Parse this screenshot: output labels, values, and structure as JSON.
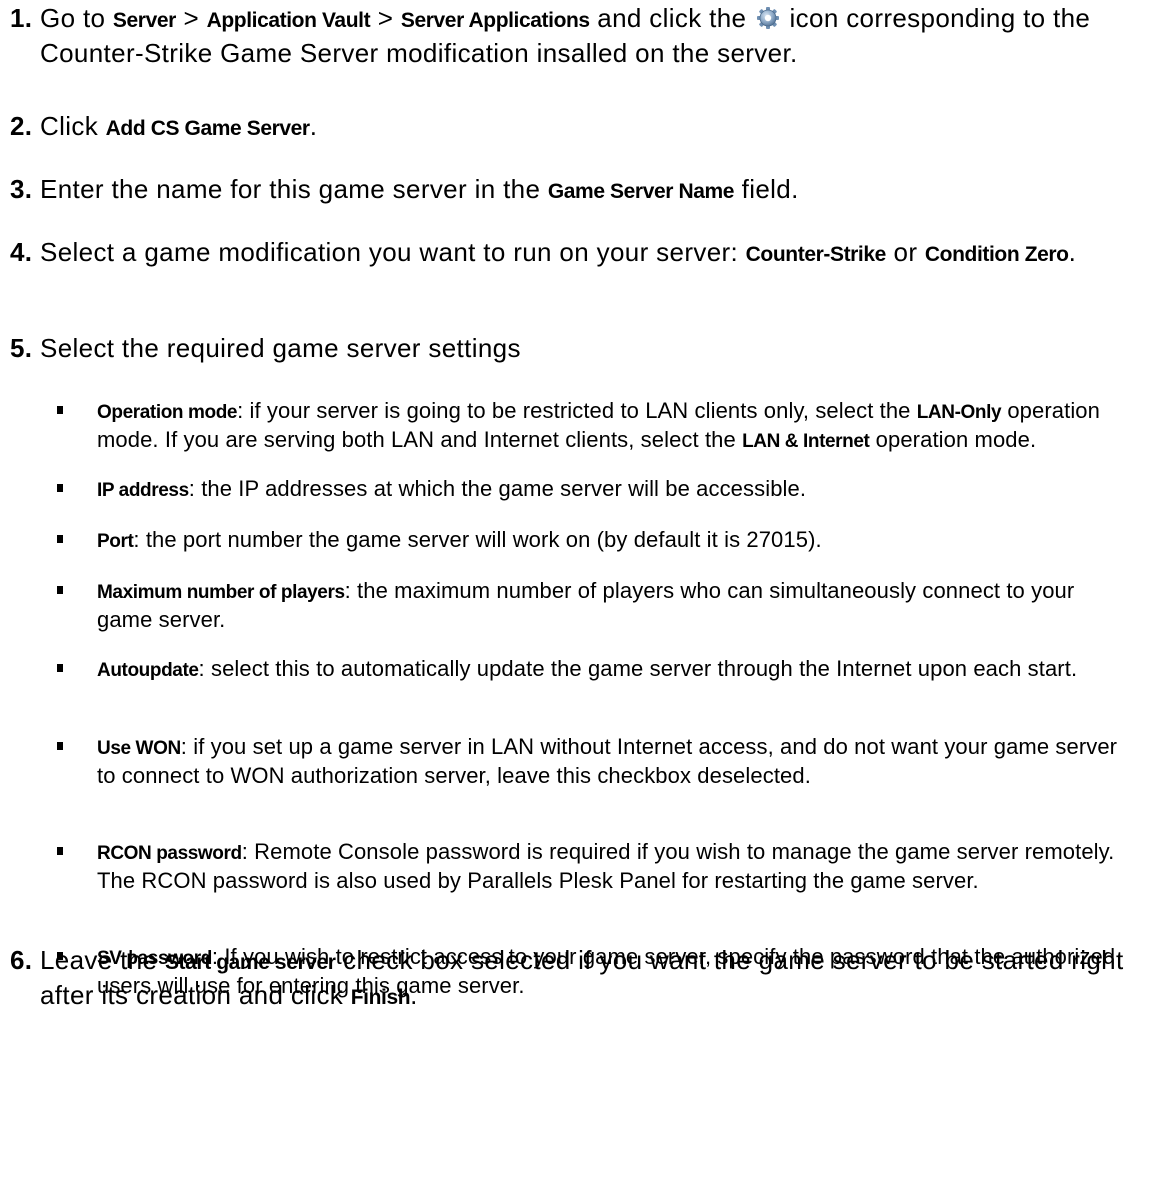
{
  "steps": [
    {
      "number": "1.",
      "parts": [
        {
          "t": "Go to "
        },
        {
          "b": "Server"
        },
        {
          "t": " > "
        },
        {
          "b": "Application Vault"
        },
        {
          "t": " > "
        },
        {
          "b": "Server Applications"
        },
        {
          "t": " and click the "
        },
        {
          "icon": "gear-icon"
        },
        {
          "t": " icon corresponding to the Counter-Strike Game Server modification insalled on the server."
        }
      ]
    },
    {
      "number": "2.",
      "parts": [
        {
          "t": "Click "
        },
        {
          "b": "Add CS Game Server"
        },
        {
          "t": "."
        }
      ]
    },
    {
      "number": "3.",
      "parts": [
        {
          "t": "Enter the name for this game server in the "
        },
        {
          "b": "Game Server Name"
        },
        {
          "t": " field."
        }
      ]
    },
    {
      "number": "4.",
      "parts": [
        {
          "t": "Select a game modification you want to run on your server: "
        },
        {
          "b": "Counter-Strike"
        },
        {
          "t": " or "
        },
        {
          "b": "Condition Zero"
        },
        {
          "t": "."
        }
      ]
    },
    {
      "number": "5.",
      "parts": [
        {
          "t": "Select the required game server settings"
        }
      ],
      "bullets": [
        [
          {
            "b": "Operation mode"
          },
          {
            "t": ": if your server is going to be restricted to LAN clients only, select the "
          },
          {
            "b": "LAN-Only"
          },
          {
            "t": " operation mode. If you are serving both LAN and Internet clients, select the "
          },
          {
            "b": "LAN & Internet"
          },
          {
            "t": " operation mode."
          }
        ],
        [
          {
            "b": "IP address"
          },
          {
            "t": ": the IP addresses at which the game server will be accessible."
          }
        ],
        [
          {
            "b": "Port"
          },
          {
            "t": ": the port number the game server will work on (by default it is 27015)."
          }
        ],
        [
          {
            "b": "Maximum number of players"
          },
          {
            "t": ": the maximum number of players who can simultaneously connect to your game server."
          }
        ],
        [
          {
            "b": "Autoupdate"
          },
          {
            "t": ": select this to automatically update the game server through the Internet upon each start."
          }
        ],
        [
          {
            "b": "Use WON"
          },
          {
            "t": ": if you set up a game server in LAN without Internet access, and do not want your game server to connect to WON authorization server, leave this checkbox deselected."
          }
        ],
        [
          {
            "b": "RCON password"
          },
          {
            "t": ": Remote Console password is required if you wish to manage the game server remotely. The RCON password is also used by Parallels Plesk Panel for restarting the game server."
          }
        ],
        [
          {
            "b": "SV password"
          },
          {
            "t": ": If you wish to restrict access to your game server, specify the password that the authorized users will use for entering this game server."
          }
        ]
      ]
    },
    {
      "number": "6.",
      "parts": [
        {
          "t": "Leave the "
        },
        {
          "b": "Start game server"
        },
        {
          "t": " check box selected if you want the game server to be started right after its creation and click "
        },
        {
          "b": "Finish"
        },
        {
          "t": "."
        }
      ]
    }
  ]
}
